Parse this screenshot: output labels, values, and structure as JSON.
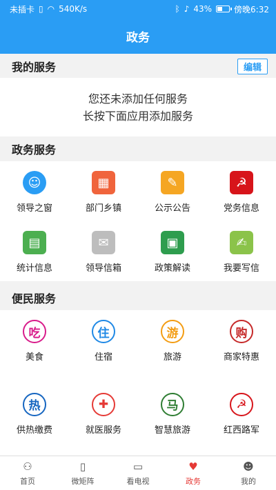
{
  "status": {
    "carrier": "未插卡",
    "speed": "540K/s",
    "battery": "43%",
    "time": "傍晚6:32",
    "battery_level": 0.43
  },
  "header": {
    "title": "政务"
  },
  "my_services": {
    "title": "我的服务",
    "edit_label": "编辑",
    "empty_line1": "您还未添加任何服务",
    "empty_line2": "长按下面应用添加服务"
  },
  "gov_services": {
    "title": "政务服务",
    "items": [
      {
        "label": "领导之窗",
        "icon": "leader-icon",
        "color": "#2a9df4"
      },
      {
        "label": "部门乡镇",
        "icon": "building-icon",
        "color": "#f0643c"
      },
      {
        "label": "公示公告",
        "icon": "notice-icon",
        "color": "#f5a623"
      },
      {
        "label": "党务信息",
        "icon": "party-icon",
        "color": "#d7141a"
      },
      {
        "label": "统计信息",
        "icon": "statistics-icon",
        "color": "#4caf50"
      },
      {
        "label": "领导信箱",
        "icon": "mailbox-icon",
        "color": "#bdbdbd"
      },
      {
        "label": "政策解读",
        "icon": "policy-icon",
        "color": "#2e9d4e"
      },
      {
        "label": "我要写信",
        "icon": "write-letter-icon",
        "color": "#8bc34a"
      }
    ]
  },
  "citizen_services": {
    "title": "便民服务",
    "items": [
      {
        "label": "美食",
        "icon": "food-icon",
        "glyph": "吃",
        "color": "#d81b8a"
      },
      {
        "label": "住宿",
        "icon": "lodging-icon",
        "glyph": "住",
        "color": "#1e88e5"
      },
      {
        "label": "旅游",
        "icon": "travel-icon",
        "glyph": "游",
        "color": "#f39c12"
      },
      {
        "label": "商家特惠",
        "icon": "merchant-icon",
        "glyph": "购",
        "color": "#c62828"
      },
      {
        "label": "供热缴费",
        "icon": "heating-icon",
        "glyph": "热",
        "color": "#1565c0"
      },
      {
        "label": "就医服务",
        "icon": "medical-icon",
        "glyph": "✚",
        "color": "#e53935"
      },
      {
        "label": "智慧旅游",
        "icon": "smart-travel-icon",
        "glyph": "马",
        "color": "#2e7d32"
      },
      {
        "label": "红西路军",
        "icon": "red-army-icon",
        "glyph": "☭",
        "color": "#d7141a"
      }
    ]
  },
  "tabs": [
    {
      "label": "首页",
      "icon": "home-icon",
      "active": false
    },
    {
      "label": "微矩阵",
      "icon": "matrix-icon",
      "active": false
    },
    {
      "label": "看电视",
      "icon": "tv-icon",
      "active": false
    },
    {
      "label": "政务",
      "icon": "gov-icon",
      "active": true
    },
    {
      "label": "我的",
      "icon": "profile-icon",
      "active": false
    }
  ]
}
